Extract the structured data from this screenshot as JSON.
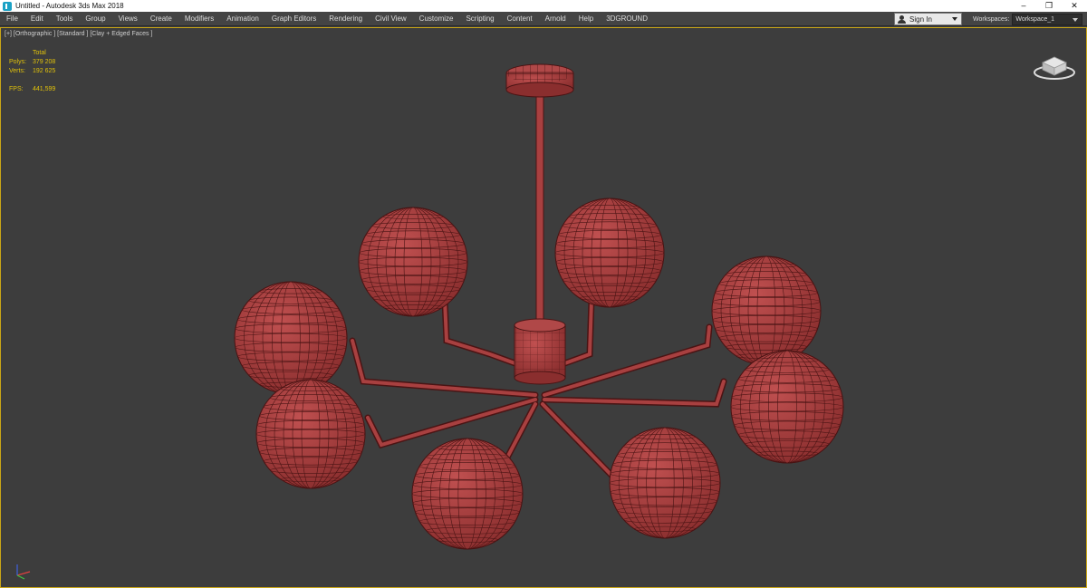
{
  "window": {
    "title": "Untitled - Autodesk 3ds Max 2018",
    "buttons": [
      "–",
      "❐",
      "✕"
    ]
  },
  "menu": [
    "File",
    "Edit",
    "Tools",
    "Group",
    "Views",
    "Create",
    "Modifiers",
    "Animation",
    "Graph Editors",
    "Rendering",
    "Civil View",
    "Customize",
    "Scripting",
    "Content",
    "Arnold",
    "Help",
    "3DGROUND"
  ],
  "signin": {
    "label": "Sign In"
  },
  "workspaces": {
    "label": "Workspaces:",
    "value": "Workspace_1"
  },
  "viewport": {
    "label": "[+] [Orthographic ] [Standard ] [Clay + Edged Faces ]",
    "stats": {
      "header": "Total",
      "polys_label": "Polys:",
      "polys": "379 208",
      "verts_label": "Verts:",
      "verts": "192 625",
      "fps_label": "FPS:",
      "fps": "441,599"
    }
  },
  "colors": {
    "clay": "#a84040",
    "wire": "#4a1414",
    "viewport_bg": "#3d3d3d",
    "active_border": "#c9a516",
    "stats": "#e0c10a"
  },
  "icons": {
    "app": "3dsmax-icon",
    "viewcube": "viewcube-icon",
    "axis": "axis-tripod-icon",
    "user": "user-icon"
  }
}
